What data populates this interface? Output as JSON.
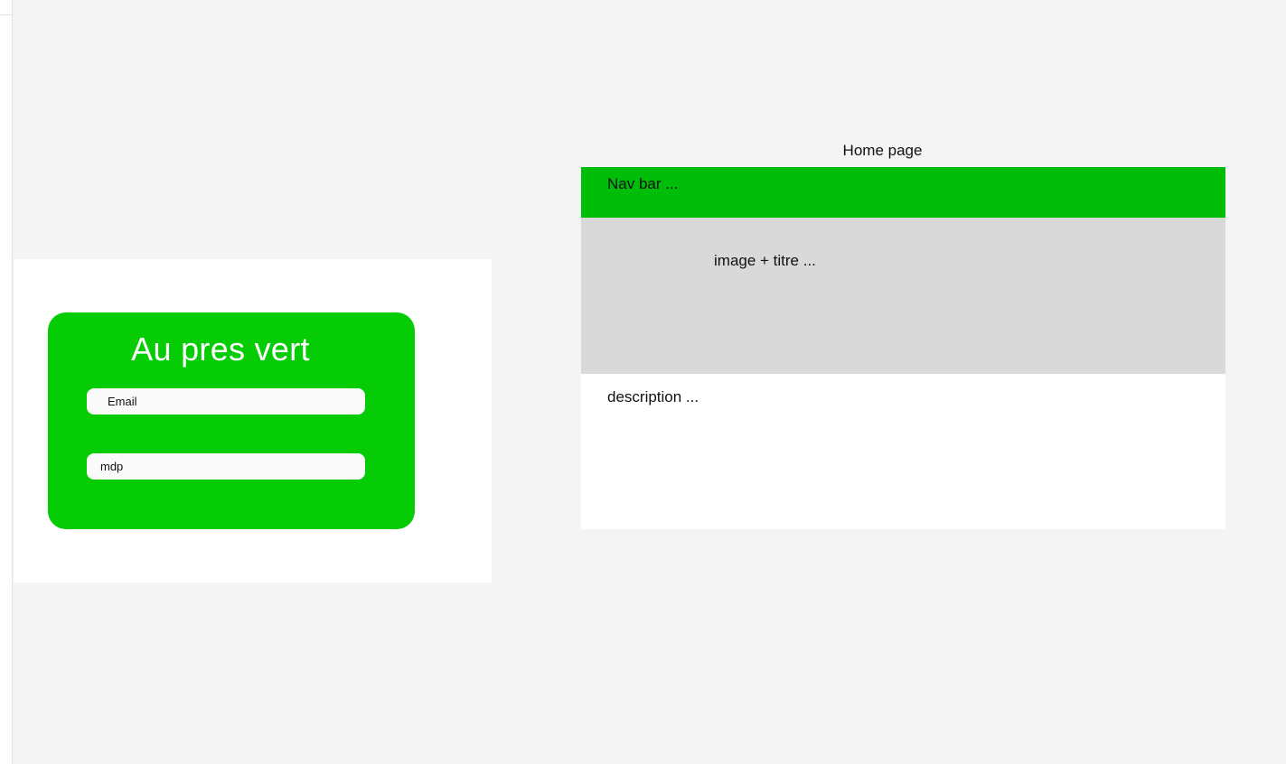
{
  "login": {
    "title": "Au pres vert",
    "email_field": "Email",
    "password_field": "mdp"
  },
  "home": {
    "frame_label": "Home page",
    "navbar_text": "Nav bar ...",
    "hero_text": "image + titre ...",
    "description_text": "description ..."
  },
  "colors": {
    "canvas_bg": "#f4f4f4",
    "login_card": "#05cc05",
    "navbar": "#00bd0a",
    "hero": "#d9d9d9",
    "frame_bg": "#ffffff"
  }
}
